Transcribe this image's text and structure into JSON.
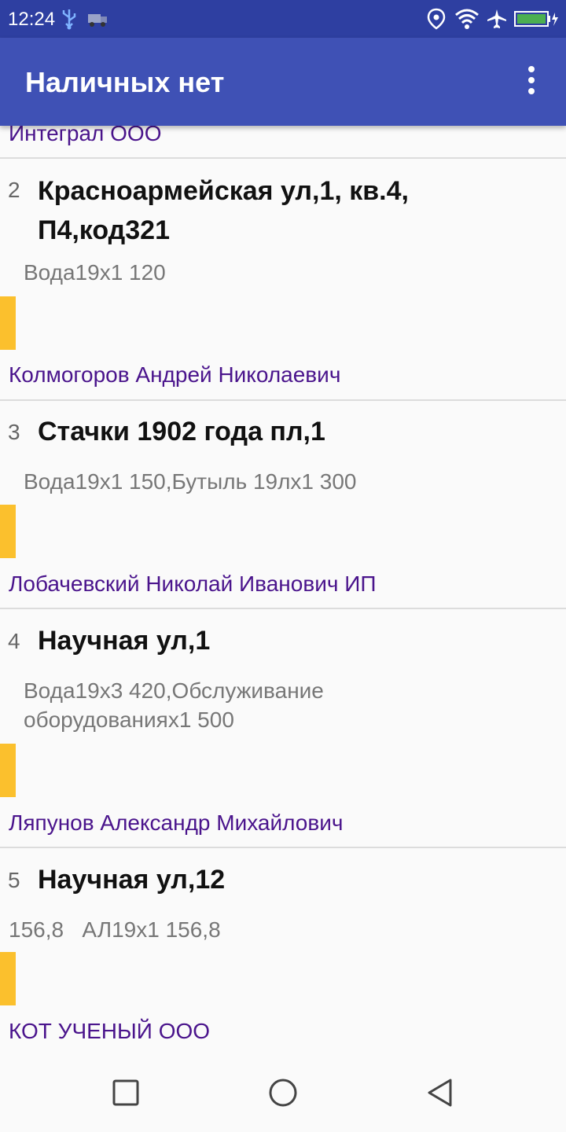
{
  "status_bar": {
    "time": "12:24",
    "icons": [
      "usb-icon",
      "truck-icon",
      "location-icon",
      "wifi-icon",
      "airplane-icon",
      "battery-charging-icon"
    ]
  },
  "app_bar": {
    "title": "Наличных нет",
    "menu_icon": "more-vert-icon"
  },
  "colors": {
    "status_bar": "#2e3fa1",
    "app_bar": "#3f51b5",
    "company_text": "#4a148c",
    "marker": "#fbc02d"
  },
  "list": {
    "partial_company": "Интеграл ООО",
    "items": [
      {
        "number": "2",
        "address": "Красноармейская ул,1, кв.4, П4,код321",
        "goods": "Вода19х1 120",
        "company": "Колмогоров Андрей Николаевич"
      },
      {
        "number": "3",
        "address": "Стачки 1902 года пл,1",
        "goods": "Вода19х1 150,Бутыль 19лх1 300",
        "company": "Лобачевский Николай Иванович ИП"
      },
      {
        "number": "4",
        "address": "Научная ул,1",
        "goods": "Вода19х3 420,Обслуживание оборудованиях1 500",
        "company": "Ляпунов Александр Михайлович"
      },
      {
        "number": "5",
        "address": "Научная ул,12",
        "goods": "156,8   АЛ19х1 156,8",
        "company": "КОТ УЧЕНЫЙ ООО"
      }
    ]
  },
  "nav_bar": {
    "buttons": [
      "recents-square-icon",
      "home-circle-icon",
      "back-triangle-icon"
    ]
  }
}
